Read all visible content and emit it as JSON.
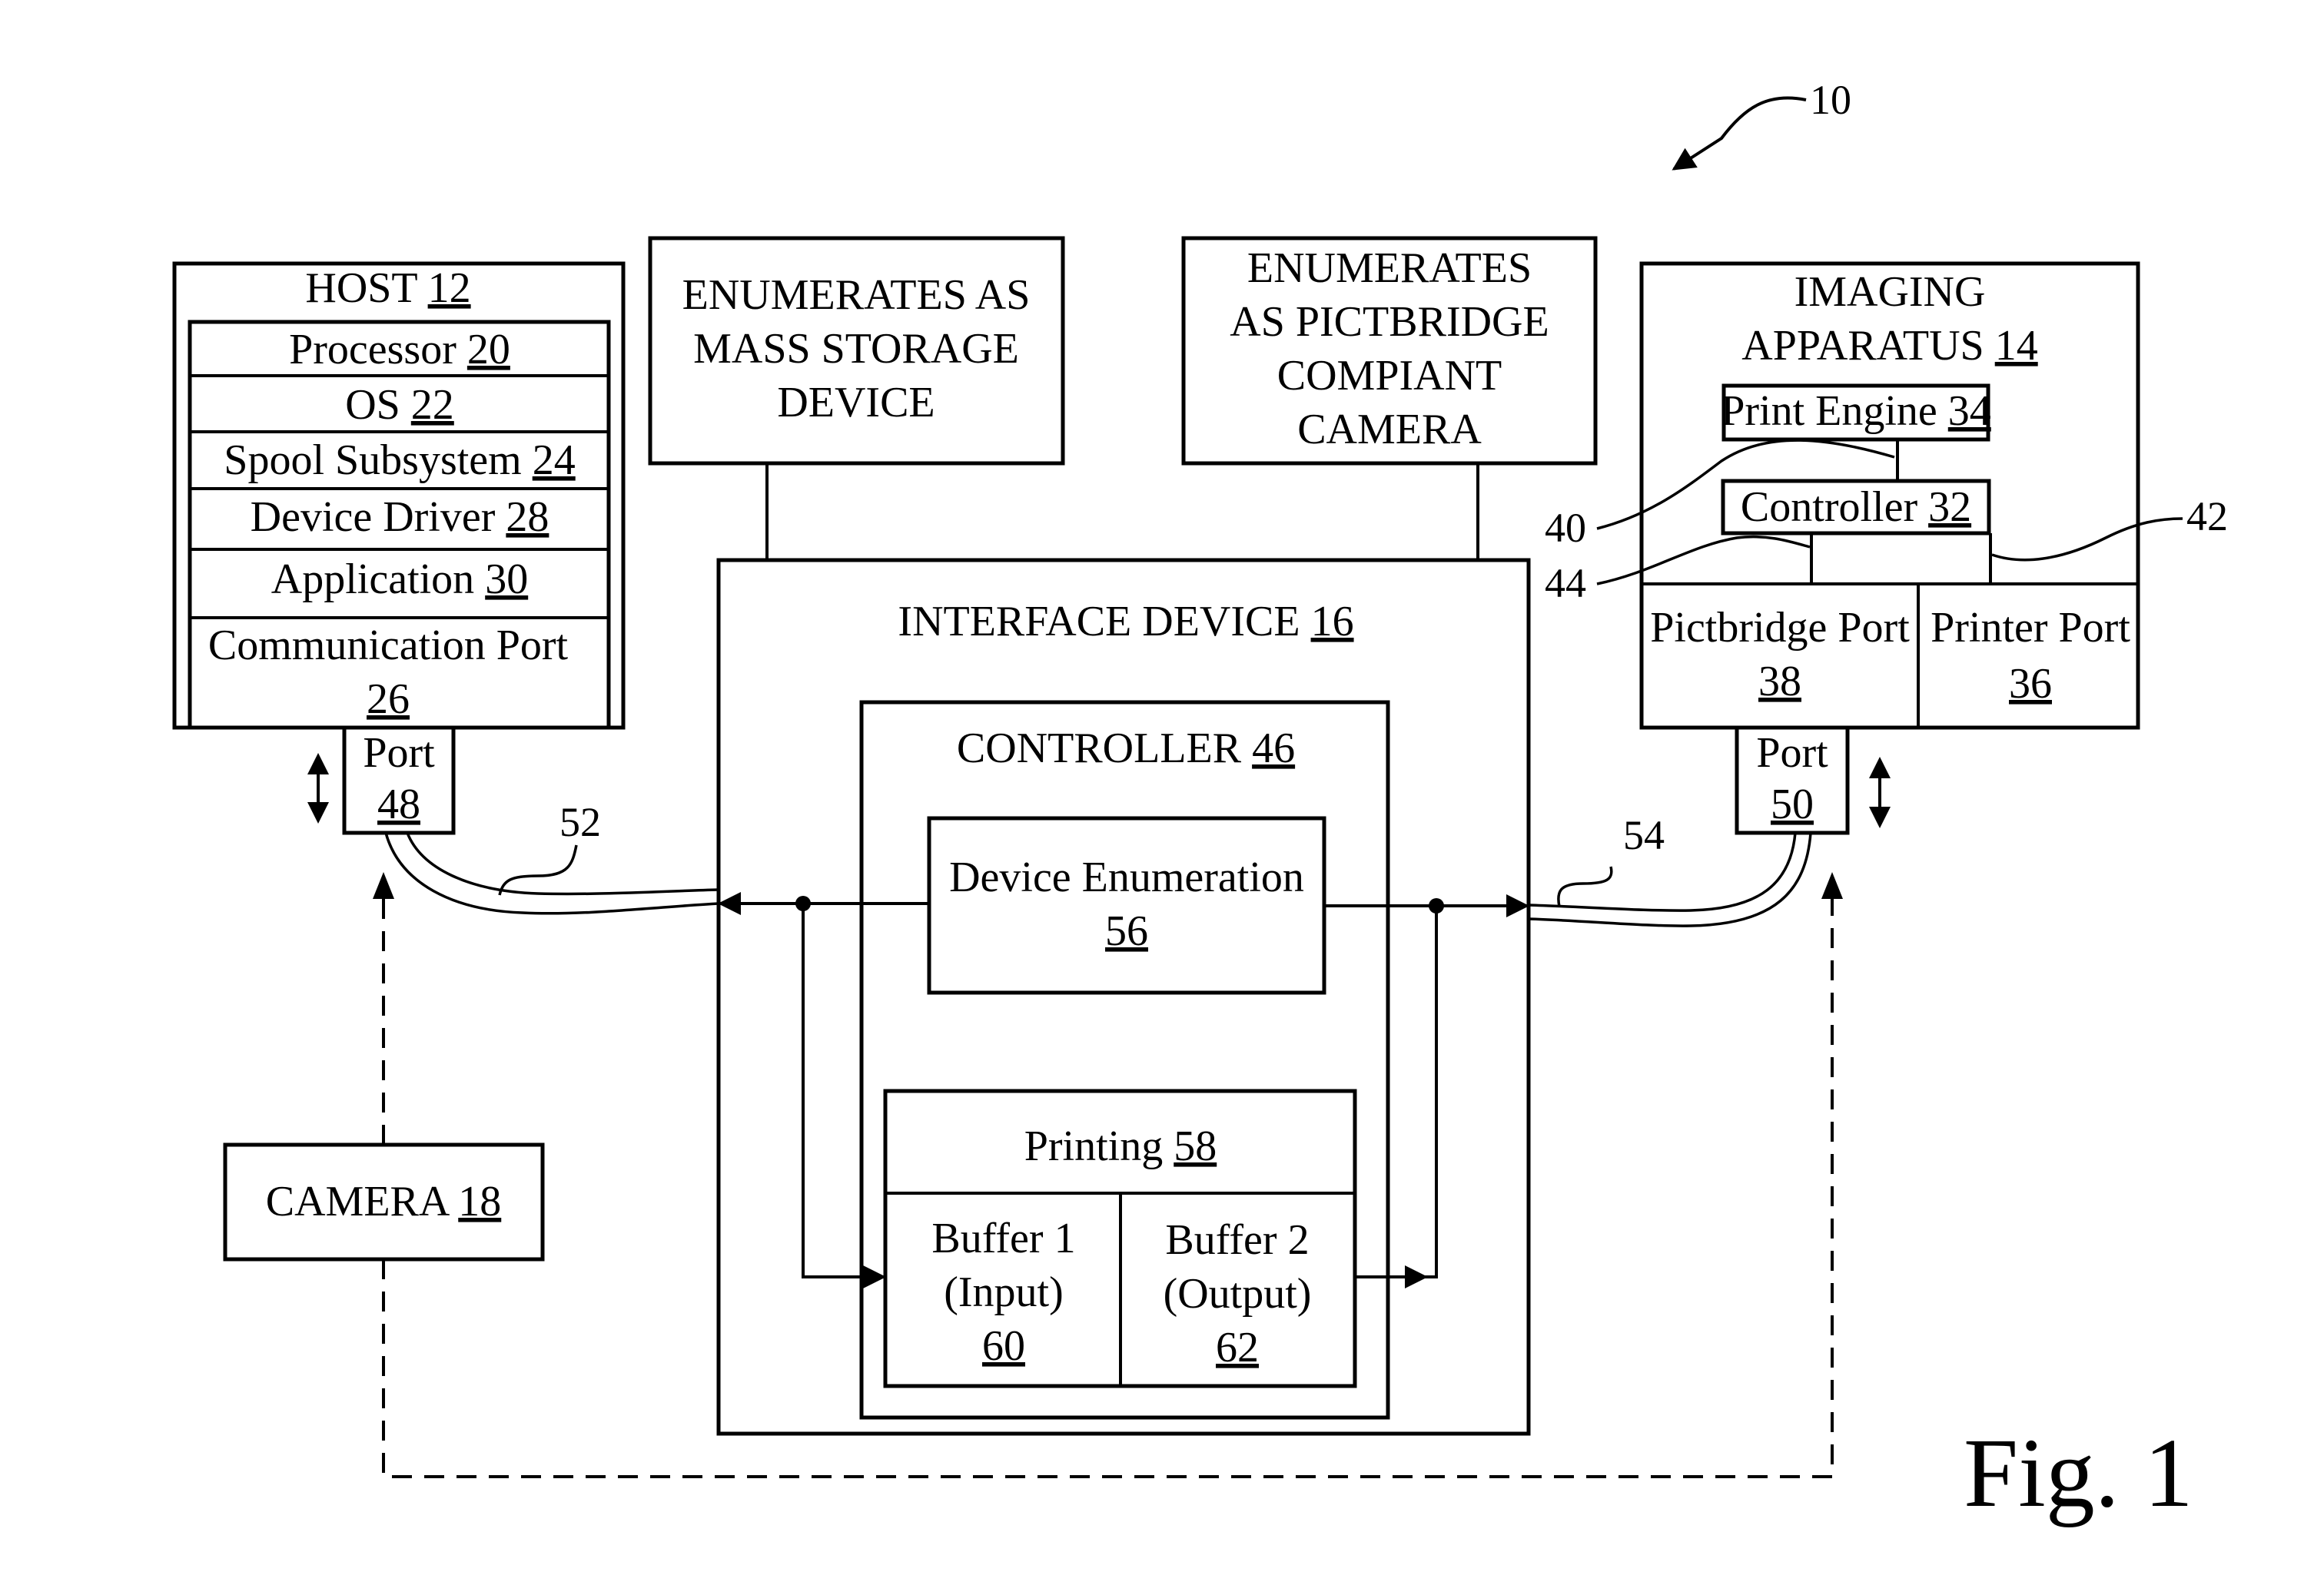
{
  "figure": {
    "label": "Fig. 1",
    "system_ref": "10"
  },
  "host": {
    "title": "HOST",
    "ref": "12",
    "components": [
      {
        "label": "Processor",
        "ref": "20"
      },
      {
        "label": "OS",
        "ref": "22"
      },
      {
        "label": "Spool Subsystem",
        "ref": "24"
      },
      {
        "label": "Device Driver",
        "ref": "28"
      },
      {
        "label": "Application",
        "ref": "30"
      },
      {
        "label": "Communication Port",
        "ref": "26"
      }
    ]
  },
  "port_host": {
    "label": "Port",
    "ref": "48"
  },
  "port_imaging": {
    "label": "Port",
    "ref": "50"
  },
  "cable_host_ref": "52",
  "cable_imaging_ref": "54",
  "mass_storage_box": {
    "lines": [
      "ENUMERATES AS",
      "MASS STORAGE",
      "DEVICE"
    ]
  },
  "pictbridge_box": {
    "lines": [
      "ENUMERATES",
      "AS PICTBRIDGE",
      "COMPIANT",
      "CAMERA"
    ]
  },
  "imaging_apparatus": {
    "title_line1": "IMAGING",
    "title_line2": "APPARATUS",
    "ref": "14",
    "print_engine": {
      "label": "Print Engine",
      "ref": "34"
    },
    "controller": {
      "label": "Controller",
      "ref": "32"
    },
    "pictbridge_port": {
      "label": "Pictbridge Port",
      "ref": "38"
    },
    "printer_port": {
      "label": "Printer Port",
      "ref": "36"
    },
    "link_refs": {
      "engine_link": "40",
      "printer_link": "42",
      "pictbridge_link": "44"
    }
  },
  "interface_device": {
    "title": "INTERFACE DEVICE",
    "ref": "16",
    "controller": {
      "title": "CONTROLLER",
      "ref": "46"
    },
    "device_enumeration": {
      "label": "Device Enumeration",
      "ref": "56"
    },
    "printing": {
      "label": "Printing",
      "ref": "58"
    },
    "buffer_input": {
      "line1": "Buffer 1",
      "line2": "(Input)",
      "ref": "60"
    },
    "buffer_output": {
      "line1": "Buffer 2",
      "line2": "(Output)",
      "ref": "62"
    }
  },
  "camera": {
    "label": "CAMERA",
    "ref": "18"
  }
}
